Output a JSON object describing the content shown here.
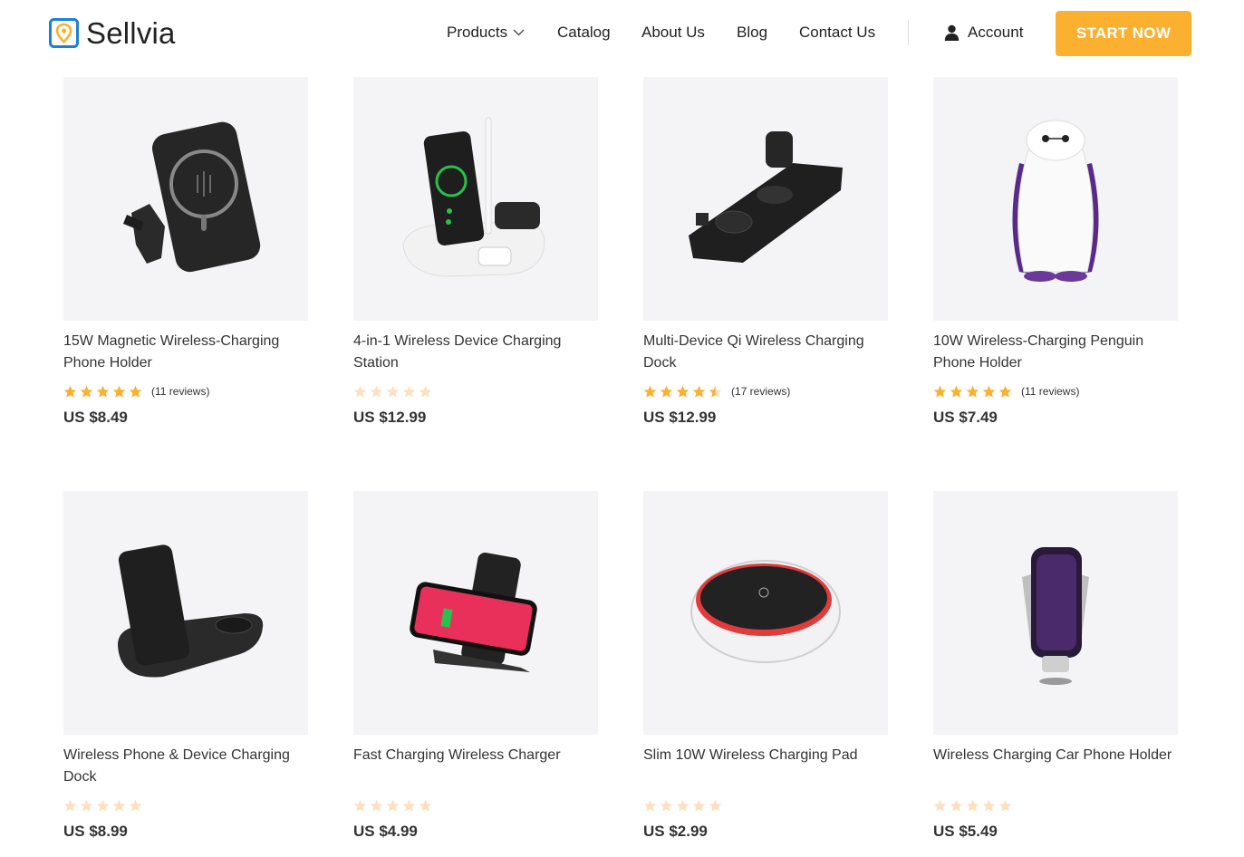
{
  "brand": {
    "name": "Sellvia"
  },
  "nav": {
    "products": "Products",
    "catalog": "Catalog",
    "about": "About Us",
    "blog": "Blog",
    "contact": "Contact Us",
    "account": "Account",
    "start": "START NOW"
  },
  "colors": {
    "accent": "#fbb12f",
    "star_filled": "#fbb12f",
    "star_empty": "#fde0c0",
    "logo_blue": "#1c7fd6"
  },
  "products": [
    {
      "name": "15W Magnetic Wireless-Charging Phone Holder",
      "rating": 5,
      "reviews": "(11 reviews)",
      "price": "US $8.49",
      "icon": "magnetic-car-holder-image"
    },
    {
      "name": "4-in-1 Wireless Device Charging Station",
      "rating": 0,
      "reviews": "",
      "price": "US $12.99",
      "icon": "charging-station-image"
    },
    {
      "name": "Multi-Device Qi Wireless Charging Dock",
      "rating": 4.5,
      "reviews": "(17 reviews)",
      "price": "US $12.99",
      "icon": "charging-dock-image"
    },
    {
      "name": "10W Wireless-Charging Penguin Phone Holder",
      "rating": 5,
      "reviews": "(11 reviews)",
      "price": "US $7.49",
      "icon": "penguin-holder-image"
    },
    {
      "name": "Wireless Phone & Device Charging Dock",
      "rating": 0,
      "reviews": "",
      "price": "US $8.99",
      "icon": "dual-charging-dock-image"
    },
    {
      "name": "Fast Charging Wireless Charger",
      "rating": 0,
      "reviews": "",
      "price": "US $4.99",
      "icon": "fast-charger-stand-image"
    },
    {
      "name": "Slim 10W Wireless Charging Pad",
      "rating": 0,
      "reviews": "",
      "price": "US $2.99",
      "icon": "charging-pad-image"
    },
    {
      "name": "Wireless Charging Car Phone Holder",
      "rating": 0,
      "reviews": "",
      "price": "US $5.49",
      "icon": "car-phone-holder-image"
    }
  ]
}
